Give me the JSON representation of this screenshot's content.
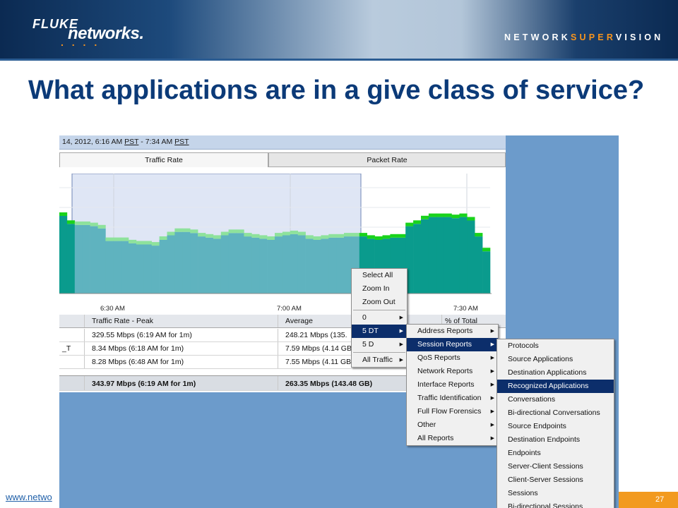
{
  "brand": {
    "fluke": "FLUKE",
    "networks": "networks.",
    "dots": ". . . .",
    "supervision_part1": "NETWORK",
    "supervision_part2": "SUPER",
    "supervision_part3": "VISION"
  },
  "slide": {
    "title": "What applications are in a give class of service?",
    "footer_link": "www.netwo",
    "page_number": "27"
  },
  "app": {
    "time_range_prefix": "14, 2012, 6:16 AM ",
    "tz1": "PST",
    "time_range_mid": " - 7:34 AM ",
    "tz2": "PST",
    "tabs": [
      "Traffic Rate",
      "Packet Rate"
    ],
    "time_ticks": [
      "6:30 AM",
      "7:00 AM",
      "7:30 AM"
    ],
    "colors": {
      "bar_fill": "#0a9b8d",
      "bar_fill_selected": "#5fb3bf",
      "bar_top_green": "#19d31b",
      "bar_top_light": "#8ee29c",
      "selection_bg": "#dfe6f5",
      "menu_highlight": "#0c2e6b"
    },
    "table": {
      "headers": [
        "",
        "Traffic Rate - Peak",
        "Average",
        "% of Total"
      ],
      "rows": [
        [
          "",
          "329.55 Mbps (6:19 AM for 1m)",
          "248.21 Mbps (135.",
          ""
        ],
        [
          "_T",
          "8.34 Mbps (6:18 AM for 1m)",
          "7.59 Mbps (4.14 GB)",
          ""
        ],
        [
          "",
          "8.28 Mbps (6:48 AM for 1m)",
          "7.55 Mbps (4.11 GB)",
          ""
        ]
      ],
      "total": [
        "",
        "343.97 Mbps (6:19 AM for 1m)",
        "263.35 Mbps (143.48 GB)",
        ""
      ]
    }
  },
  "menus": {
    "main": {
      "items": [
        "Select All",
        "Zoom In",
        "Zoom Out"
      ],
      "submenu_items": [
        {
          "label": "0",
          "arrow": true,
          "selected": false
        },
        {
          "label": "5 DT",
          "arrow": true,
          "selected": true
        },
        {
          "label": "5 D",
          "arrow": true,
          "selected": false
        }
      ],
      "all_traffic": "All Traffic"
    },
    "reports": {
      "items": [
        {
          "label": "Address Reports",
          "selected": false
        },
        {
          "label": "Session Reports",
          "selected": true
        },
        {
          "label": "QoS Reports",
          "selected": false
        },
        {
          "label": "Network Reports",
          "selected": false
        },
        {
          "label": "Interface Reports",
          "selected": false
        },
        {
          "label": "Traffic Identification",
          "selected": false
        },
        {
          "label": "Full Flow Forensics",
          "selected": false
        },
        {
          "label": "Other",
          "selected": false
        },
        {
          "label": "All Reports",
          "selected": false
        }
      ]
    },
    "session": {
      "items": [
        {
          "label": "Protocols",
          "selected": false
        },
        {
          "label": "Source Applications",
          "selected": false
        },
        {
          "label": "Destination Applications",
          "selected": false
        },
        {
          "label": "Recognized Applications",
          "selected": true
        },
        {
          "label": "Conversations",
          "selected": false
        },
        {
          "label": "Bi-directional Conversations",
          "selected": false
        },
        {
          "label": "Source Endpoints",
          "selected": false
        },
        {
          "label": "Destination Endpoints",
          "selected": false
        },
        {
          "label": "Endpoints",
          "selected": false
        },
        {
          "label": "Server-Client Sessions",
          "selected": false
        },
        {
          "label": "Client-Server Sessions",
          "selected": false
        },
        {
          "label": "Sessions",
          "selected": false
        },
        {
          "label": "Bi-directional Sessions",
          "selected": false
        }
      ]
    }
  }
}
